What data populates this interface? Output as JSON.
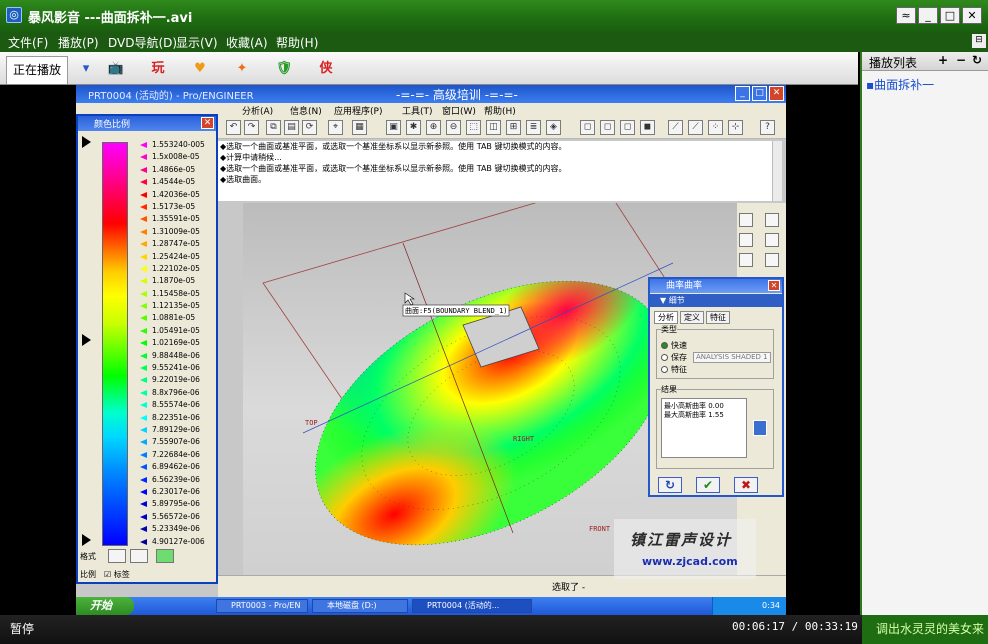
{
  "window": {
    "title": "暴风影音 ---曲面拆补一.avi"
  },
  "menu": [
    "文件(F)",
    "播放(P)",
    "DVD导航(D)",
    "显示(V)",
    "收藏(A)",
    "帮助(H)"
  ],
  "tabs": {
    "now_playing": "正在播放",
    "icons": [
      "▾",
      "📺",
      "玩",
      "♥",
      "✦",
      "🛡",
      "侠"
    ]
  },
  "playlist": {
    "title": "播放列表",
    "items": [
      "曲面拆补一"
    ]
  },
  "proe": {
    "title_left": "PRT0004 (活动的) - Pro/ENGINEER",
    "title_mid": "-=-=- 高级培训 -=-=-",
    "menu": [
      "文件(F)",
      "编辑(E)",
      "视图(V)",
      "插入(I)",
      "分析(A)",
      "信息(N)",
      "应用程序(P)",
      "工具(T)",
      "窗口(W)",
      "帮助(H)"
    ],
    "messages": [
      "◆选取一个曲面或基准平面，或选取一个基准坐标系以显示新参照。使用 TAB 键切换模式的内容。",
      "◆计算中请稍候...",
      "◆选取一个曲面或基准平面，或选取一个基准坐标系以显示新参照。使用 TAB 键切换模式的内容。",
      "◆选取曲面。"
    ],
    "status_text": "选取了 -"
  },
  "colorbar": {
    "title": "颜色比例",
    "labels": [
      "1.553240-005",
      "1.5x008e-05",
      "1.4866e-05",
      "1.4544e-05",
      "1.42036e-05",
      "1.5173e-05",
      "1.35591e-05",
      "1.31009e-05",
      "1.28747e-05",
      "1.25424e-05",
      "1.22102e-05",
      "1.1870e-05",
      "1.15458e-05",
      "1.12135e-05",
      "1.0881e-05",
      "1.05491e-05",
      "1.02169e-05",
      "9.88448e-06",
      "9.55241e-06",
      "9.22019e-06",
      "8.8x796e-06",
      "8.55574e-06",
      "8.22351e-06",
      "7.89129e-06",
      "7.55907e-06",
      "7.22684e-06",
      "6.89462e-06",
      "6.56239e-06",
      "6.23017e-06",
      "5.89795e-06",
      "5.56572e-06",
      "5.23349e-06",
      "4.90127e-006"
    ],
    "marker_colors": [
      "#ff00ff",
      "#ff00cc",
      "#ff0088",
      "#ff0040",
      "#ff0000",
      "#ff2a00",
      "#ff5500",
      "#ff8000",
      "#ffaa00",
      "#ffd400",
      "#ffff00",
      "#d4ff00",
      "#aaff00",
      "#80ff00",
      "#55ff00",
      "#2aff00",
      "#00ff00",
      "#00ff2a",
      "#00ff55",
      "#00ff80",
      "#00ffaa",
      "#00ffd4",
      "#00ffff",
      "#00d4ff",
      "#00aaff",
      "#0080ff",
      "#0055ff",
      "#002aff",
      "#0000ff",
      "#0000e0",
      "#0000c8",
      "#0000b0",
      "#000098"
    ],
    "bottom_label_1": "格式",
    "bottom_label_2": "比例",
    "checkbox_label": "☑ 标签"
  },
  "detail": {
    "title": "曲率曲率",
    "subtitle": "▼ 细节",
    "tabs": [
      "分析",
      "定义",
      "特征"
    ],
    "group_type": "类型",
    "radios": [
      "快速",
      "保存",
      "特征"
    ],
    "input_placeholder": "ANALYSIS SHADED 1",
    "group_result": "结果",
    "results": [
      "最小高斯曲率  0.00",
      "最大高斯曲率  1.55"
    ],
    "ok_symbol": "✔",
    "cancel_symbol": "✖",
    "refresh_symbol": "↻"
  },
  "surface_label": "曲面:F5(BOUNDARY BLEND_1)",
  "ref_labels": [
    "TOP",
    "RIGHT",
    "FRONT"
  ],
  "taskbar": {
    "start": "开始",
    "items": [
      "PRT0003 - Pro/EN",
      "本地磁盘 (D:)",
      "PRT0004 (活动的..."
    ],
    "clock": "0:34"
  },
  "watermark": {
    "line1": "镇江雷声设计",
    "line2": "www.zjcad.com"
  },
  "status": {
    "state": "暂停",
    "time": "00:06:17 / 00:33:19",
    "ad": "调出水灵灵的美女来"
  }
}
